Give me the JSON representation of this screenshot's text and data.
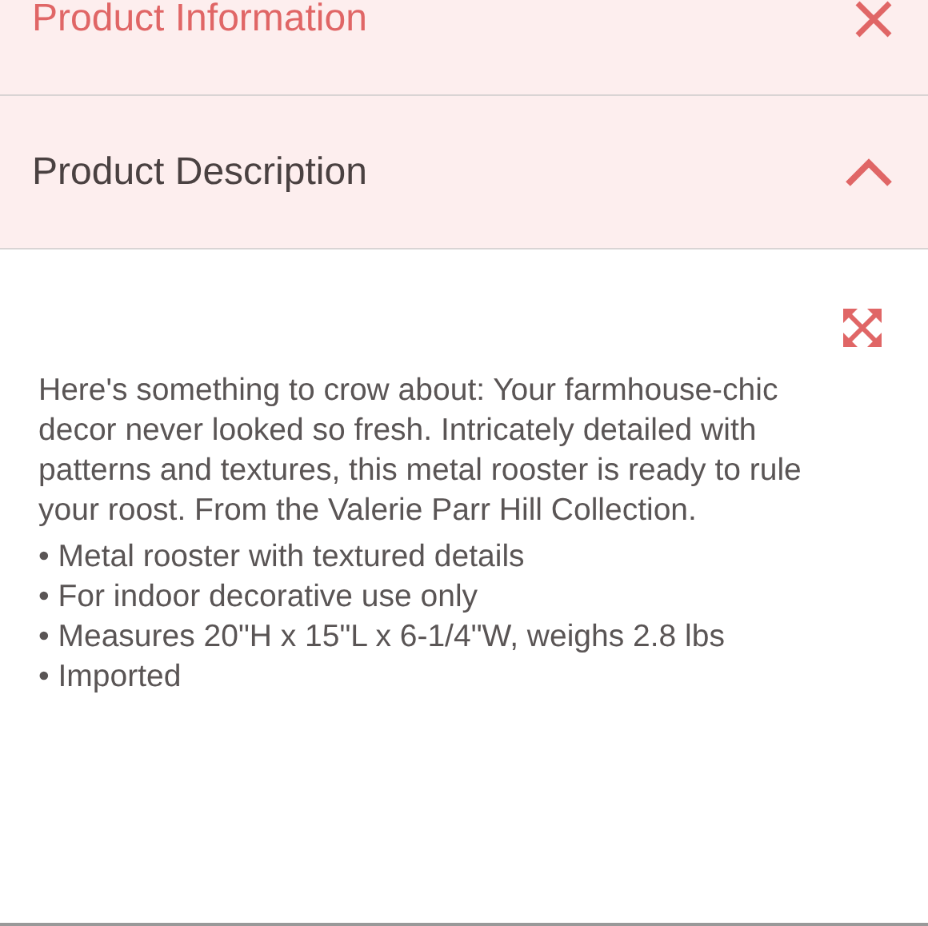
{
  "sections": [
    {
      "title": "Product Information",
      "kind": "close",
      "active": true
    },
    {
      "title": "Product Description",
      "kind": "toggle",
      "active": false,
      "expanded": true
    }
  ],
  "description": {
    "paragraph": "Here's something to crow about: Your farmhouse-chic decor never looked so fresh. Intricately detailed with patterns and textures, this metal rooster is ready to rule your roost. From the Valerie Parr Hill Collection.",
    "bullets": [
      "• Metal rooster with textured details",
      "• For indoor decorative use only",
      "• Measures 20\"H x 15\"L x 6-1/4\"W, weighs 2.8 lbs",
      "• Imported"
    ]
  }
}
